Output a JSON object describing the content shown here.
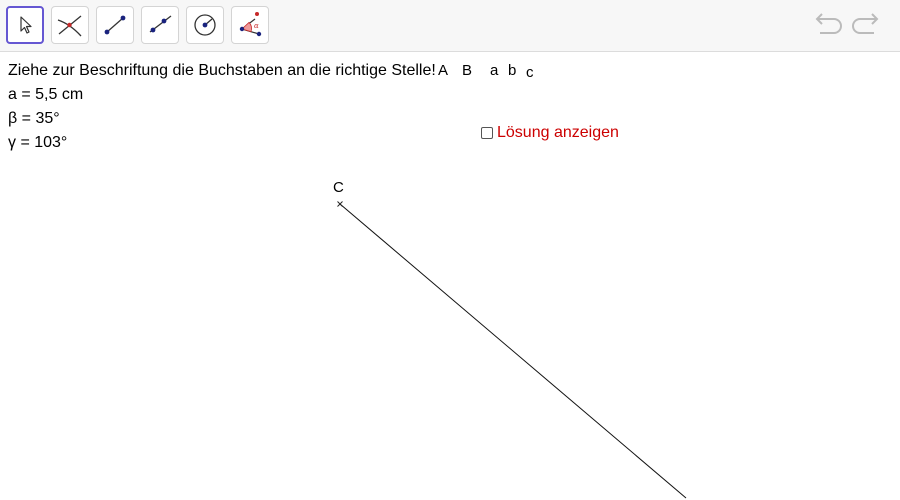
{
  "toolbar": {
    "tools": [
      "move-tool",
      "intersect-tool",
      "segment-tool",
      "segment-fixed-length-tool",
      "circle-center-radius-tool",
      "angle-given-size-tool"
    ],
    "undo_icon": "undo-icon",
    "redo_icon": "redo-icon"
  },
  "task": {
    "instruction": "Ziehe zur Beschriftung die Buchstaben an die richtige Stelle!",
    "given_a": "a = 5,5 cm",
    "given_beta": "β = 35°",
    "given_gamma": "γ = 103°"
  },
  "letters": {
    "A": "A",
    "B": "B",
    "a": "a",
    "b": "b",
    "c": "c"
  },
  "solution": {
    "label": "Lösung anzeigen",
    "checked": false
  },
  "point": {
    "label": "C"
  },
  "colors": {
    "accent": "#6557d2",
    "solution_text": "#cc0000",
    "point_blue": "#1a237e",
    "angle_red": "#c62828"
  }
}
